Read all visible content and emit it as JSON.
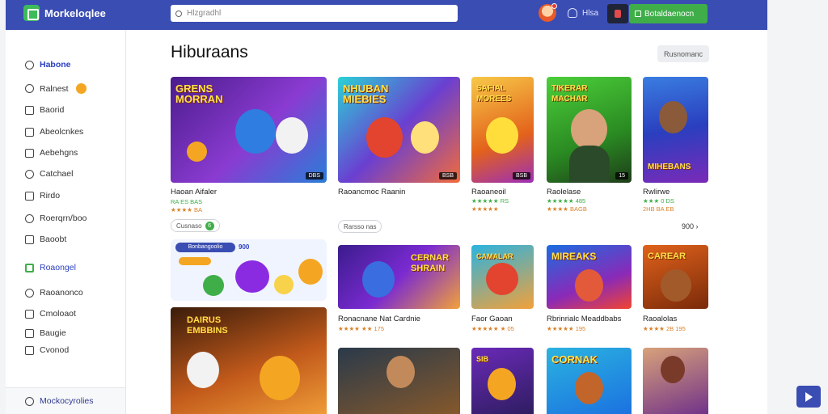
{
  "header": {
    "app_name": "Morkeloqlee",
    "search_placeholder": "Hlzgradhl",
    "user_label": "Hlsa",
    "cta_label": "Botaldaenocn"
  },
  "sidebar": {
    "items": [
      {
        "label": "Habone",
        "icon": "home-icon"
      },
      {
        "label": "Ralnest",
        "icon": "coin-icon"
      },
      {
        "label": "Baorid",
        "icon": "board-icon"
      },
      {
        "label": "Abeolcnkes",
        "icon": "apps-icon"
      },
      {
        "label": "Aebehgns",
        "icon": "edit-icon"
      },
      {
        "label": "Catchael",
        "icon": "chat-icon"
      },
      {
        "label": "Rirdo",
        "icon": "folder-icon"
      },
      {
        "label": "Roerqrn/boo",
        "icon": "search-icon"
      },
      {
        "label": "Baoobt",
        "icon": "grid-icon"
      },
      {
        "label": "Roaongel",
        "icon": "game-icon"
      },
      {
        "label": "Raoanonco",
        "icon": "user-icon"
      },
      {
        "label": "Cmoloaot",
        "icon": "chart-icon"
      },
      {
        "label": "Baugie",
        "icon": "tag-icon"
      },
      {
        "label": "Cvonod",
        "icon": "doc-icon"
      }
    ],
    "footer_label": "Mockocyrolies"
  },
  "main": {
    "title": "Hiburaans",
    "top_button": "Rusnomanc",
    "cards": [
      {
        "art": "GRENS\nMORRAN",
        "title": "Haoan Aifaler",
        "sub1": "RA ES BAS",
        "sub2": "★★★★ BA",
        "tag": "DBS"
      },
      {
        "art": "NHUBAN\nMIEBIES",
        "title": "Raoancmoc Raanin",
        "sub1": "",
        "sub2": "",
        "tag": "BSB"
      },
      {
        "art": "SAFIAL\nMOREES",
        "title": "Raoaneoil",
        "sub1": "★★★★★ RS",
        "sub2": "★★★★★",
        "tag": "BSB"
      },
      {
        "art": "TIKERAR\nMACHAR",
        "title": "Raolelase",
        "sub1": "★★★★★ 485",
        "sub2": "★★★★ BAGB",
        "tag": "15"
      },
      {
        "art": "MIHEBANS",
        "title": "Rwlirwe",
        "sub1": "★★★ 0 DS",
        "sub2": "2HB BA EB",
        "tag": ""
      }
    ],
    "chip_left": "Cusnaso",
    "chip_badge": "6",
    "chip_mid": "Rarsso nas",
    "more_link": "900 ›",
    "promo_bar": "Bonbangoolio",
    "promo_extra": "900",
    "row2": [
      {
        "art": "CERNAR\nSHRAIN",
        "title": "Ronacnane Nat Cardnie",
        "sub": "★★★★ ★★ 175"
      },
      {
        "art": "CAMALAR",
        "title": "Faor Gaoan",
        "sub": "★★★★★ ★ 05"
      },
      {
        "art": "MIREAKS",
        "title": "Rbrinrialc Meaddbabs",
        "sub": "★★★★★ 195"
      },
      {
        "art": "CAREAR",
        "title": "Raoalolas",
        "sub": "★★★★ 2B 195"
      }
    ],
    "row3": [
      {
        "art": "DAIRUS\nEMBBINS"
      },
      {
        "art": ""
      },
      {
        "art": "SIB"
      },
      {
        "art": "CORNAK"
      },
      {
        "art": ""
      }
    ]
  }
}
